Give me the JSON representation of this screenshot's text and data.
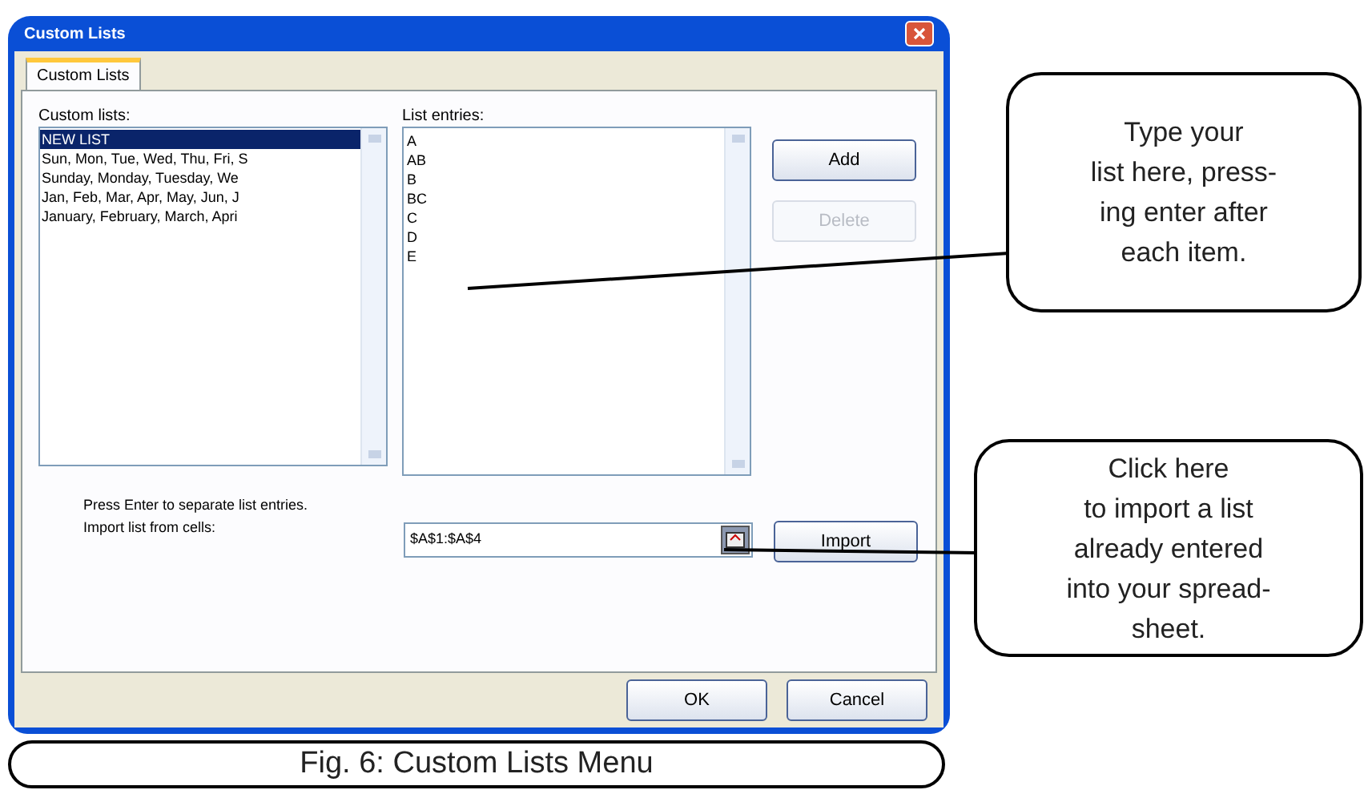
{
  "window": {
    "title": "Custom Lists"
  },
  "tabs": [
    {
      "label": "Custom Lists",
      "selected": true
    }
  ],
  "custom_lists": {
    "label": "Custom lists:",
    "items": [
      {
        "text": "NEW LIST",
        "selected": true
      },
      {
        "text": "Sun, Mon, Tue, Wed, Thu, Fri, S",
        "selected": false
      },
      {
        "text": "Sunday, Monday, Tuesday, We",
        "selected": false
      },
      {
        "text": "Jan, Feb, Mar, Apr, May, Jun, J",
        "selected": false
      },
      {
        "text": "January, February, March, Apri",
        "selected": false
      }
    ]
  },
  "list_entries": {
    "label": "List entries:",
    "items": [
      "A",
      "AB",
      "B",
      "BC",
      "C",
      "D",
      "E"
    ]
  },
  "side_buttons": [
    {
      "label": "Add",
      "disabled": false
    },
    {
      "label": "Delete",
      "disabled": true
    }
  ],
  "hint": "Press Enter to separate list entries.",
  "import": {
    "label": "Import list from cells:",
    "value": "$A$1:$A$4",
    "button": "Import"
  },
  "footer_buttons": [
    "OK",
    "Cancel"
  ],
  "callouts": [
    {
      "lines": [
        "Type your",
        "list here, press-",
        "ing enter after",
        "each item."
      ]
    },
    {
      "lines": [
        "Click here",
        "to import a list",
        "already entered",
        "into your spread-",
        "sheet."
      ]
    }
  ],
  "caption": "Fig. 6:  Custom Lists Menu"
}
